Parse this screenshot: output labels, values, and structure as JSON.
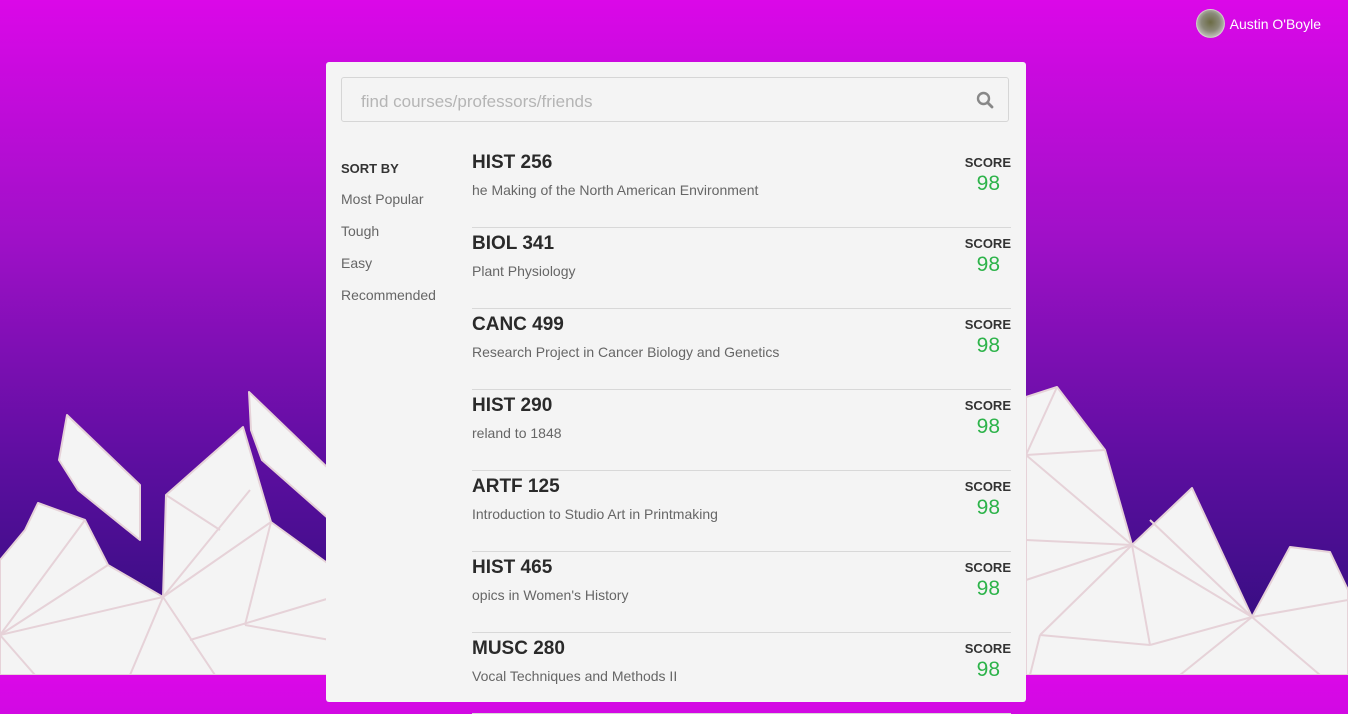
{
  "user": {
    "name": "Austin O'Boyle"
  },
  "search": {
    "placeholder": "find courses/professors/friends"
  },
  "sort": {
    "title": "SORT BY",
    "options": [
      "Most Popular",
      "Tough",
      "Easy",
      "Recommended"
    ]
  },
  "courses": [
    {
      "code": "HIST 256",
      "name": "he Making of the North American Environment",
      "score_label": "SCORE",
      "score": "98"
    },
    {
      "code": "BIOL 341",
      "name": "Plant Physiology",
      "score_label": "SCORE",
      "score": "98"
    },
    {
      "code": "CANC 499",
      "name": "Research Project in Cancer Biology and Genetics",
      "score_label": "SCORE",
      "score": "98"
    },
    {
      "code": "HIST 290",
      "name": "reland to 1848",
      "score_label": "SCORE",
      "score": "98"
    },
    {
      "code": "ARTF 125",
      "name": "Introduction to Studio Art in Printmaking",
      "score_label": "SCORE",
      "score": "98"
    },
    {
      "code": "HIST 465",
      "name": "opics in Women's History",
      "score_label": "SCORE",
      "score": "98"
    },
    {
      "code": "MUSC 280",
      "name": "Vocal Techniques and Methods II",
      "score_label": "SCORE",
      "score": "98"
    }
  ],
  "colors": {
    "score": "#2db34a",
    "gradient_top": "#db08e8",
    "gradient_bottom": "#2b0d78"
  }
}
